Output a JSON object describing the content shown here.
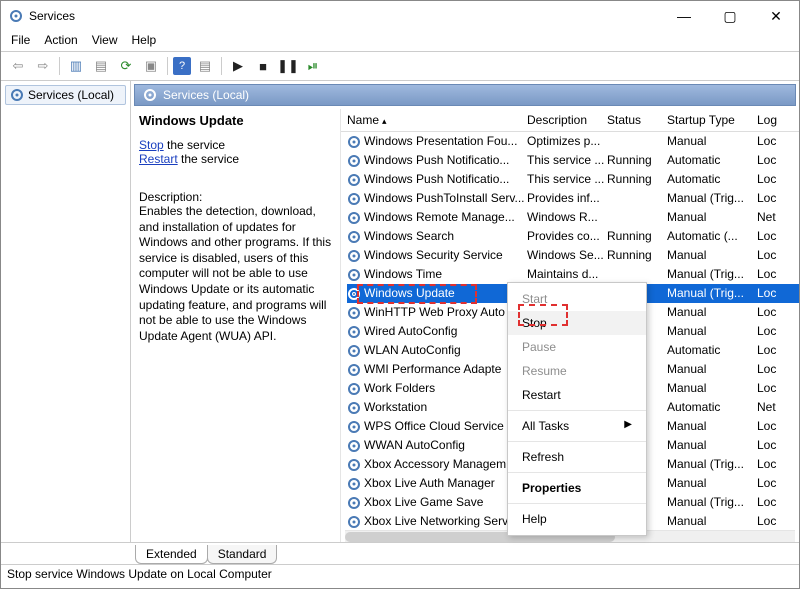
{
  "window": {
    "title": "Services"
  },
  "menubar": [
    "File",
    "Action",
    "View",
    "Help"
  ],
  "left_tree": {
    "item": "Services (Local)"
  },
  "panel_header": "Services (Local)",
  "detail": {
    "title": "Windows Update",
    "stop_link": "Stop",
    "stop_suffix": " the service",
    "restart_link": "Restart",
    "restart_suffix": " the service",
    "desc_label": "Description:",
    "description": "Enables the detection, download, and installation of updates for Windows and other programs. If this service is disabled, users of this computer will not be able to use Windows Update or its automatic updating feature, and programs will not be able to use the Windows Update Agent (WUA) API."
  },
  "columns": {
    "name": "Name",
    "description": "Description",
    "status": "Status",
    "startup": "Startup Type",
    "logon": "Log"
  },
  "services": [
    {
      "name": "Windows Presentation Fou...",
      "desc": "Optimizes p...",
      "status": "",
      "startup": "Manual",
      "logon": "Loc"
    },
    {
      "name": "Windows Push Notificatio...",
      "desc": "This service ...",
      "status": "Running",
      "startup": "Automatic",
      "logon": "Loc"
    },
    {
      "name": "Windows Push Notificatio...",
      "desc": "This service ...",
      "status": "Running",
      "startup": "Automatic",
      "logon": "Loc"
    },
    {
      "name": "Windows PushToInstall Serv...",
      "desc": "Provides inf...",
      "status": "",
      "startup": "Manual (Trig...",
      "logon": "Loc"
    },
    {
      "name": "Windows Remote Manage...",
      "desc": "Windows R...",
      "status": "",
      "startup": "Manual",
      "logon": "Net"
    },
    {
      "name": "Windows Search",
      "desc": "Provides co...",
      "status": "Running",
      "startup": "Automatic (...",
      "logon": "Loc"
    },
    {
      "name": "Windows Security Service",
      "desc": "Windows Se...",
      "status": "Running",
      "startup": "Manual",
      "logon": "Loc"
    },
    {
      "name": "Windows Time",
      "desc": "Maintains d...",
      "status": "",
      "startup": "Manual (Trig...",
      "logon": "Loc"
    },
    {
      "name": "Windows Update",
      "desc": "",
      "status": "",
      "startup": "Manual (Trig...",
      "logon": "Loc",
      "selected": true
    },
    {
      "name": "WinHTTP Web Proxy Auto",
      "desc": "",
      "status": "",
      "startup": "Manual",
      "logon": "Loc"
    },
    {
      "name": "Wired AutoConfig",
      "desc": "",
      "status": "",
      "startup": "Manual",
      "logon": "Loc"
    },
    {
      "name": "WLAN AutoConfig",
      "desc": "",
      "status": "",
      "startup": "Automatic",
      "logon": "Loc"
    },
    {
      "name": "WMI Performance Adapte",
      "desc": "",
      "status": "",
      "startup": "Manual",
      "logon": "Loc"
    },
    {
      "name": "Work Folders",
      "desc": "",
      "status": "",
      "startup": "Manual",
      "logon": "Loc"
    },
    {
      "name": "Workstation",
      "desc": "",
      "status": "",
      "startup": "Automatic",
      "logon": "Net"
    },
    {
      "name": "WPS Office Cloud Service",
      "desc": "",
      "status": "",
      "startup": "Manual",
      "logon": "Loc"
    },
    {
      "name": "WWAN AutoConfig",
      "desc": "",
      "status": "",
      "startup": "Manual",
      "logon": "Loc"
    },
    {
      "name": "Xbox Accessory Managem",
      "desc": "",
      "status": "",
      "startup": "Manual (Trig...",
      "logon": "Loc"
    },
    {
      "name": "Xbox Live Auth Manager",
      "desc": "",
      "status": "",
      "startup": "Manual",
      "logon": "Loc"
    },
    {
      "name": "Xbox Live Game Save",
      "desc": "",
      "status": "",
      "startup": "Manual (Trig...",
      "logon": "Loc"
    },
    {
      "name": "Xbox Live Networking Serv",
      "desc": "",
      "status": "",
      "startup": "Manual",
      "logon": "Loc"
    }
  ],
  "context_menu": {
    "start": "Start",
    "stop": "Stop",
    "pause": "Pause",
    "resume": "Resume",
    "restart": "Restart",
    "all_tasks": "All Tasks",
    "refresh": "Refresh",
    "properties": "Properties",
    "help": "Help"
  },
  "tabs": {
    "extended": "Extended",
    "standard": "Standard"
  },
  "status_bar": "Stop service Windows Update on Local Computer"
}
